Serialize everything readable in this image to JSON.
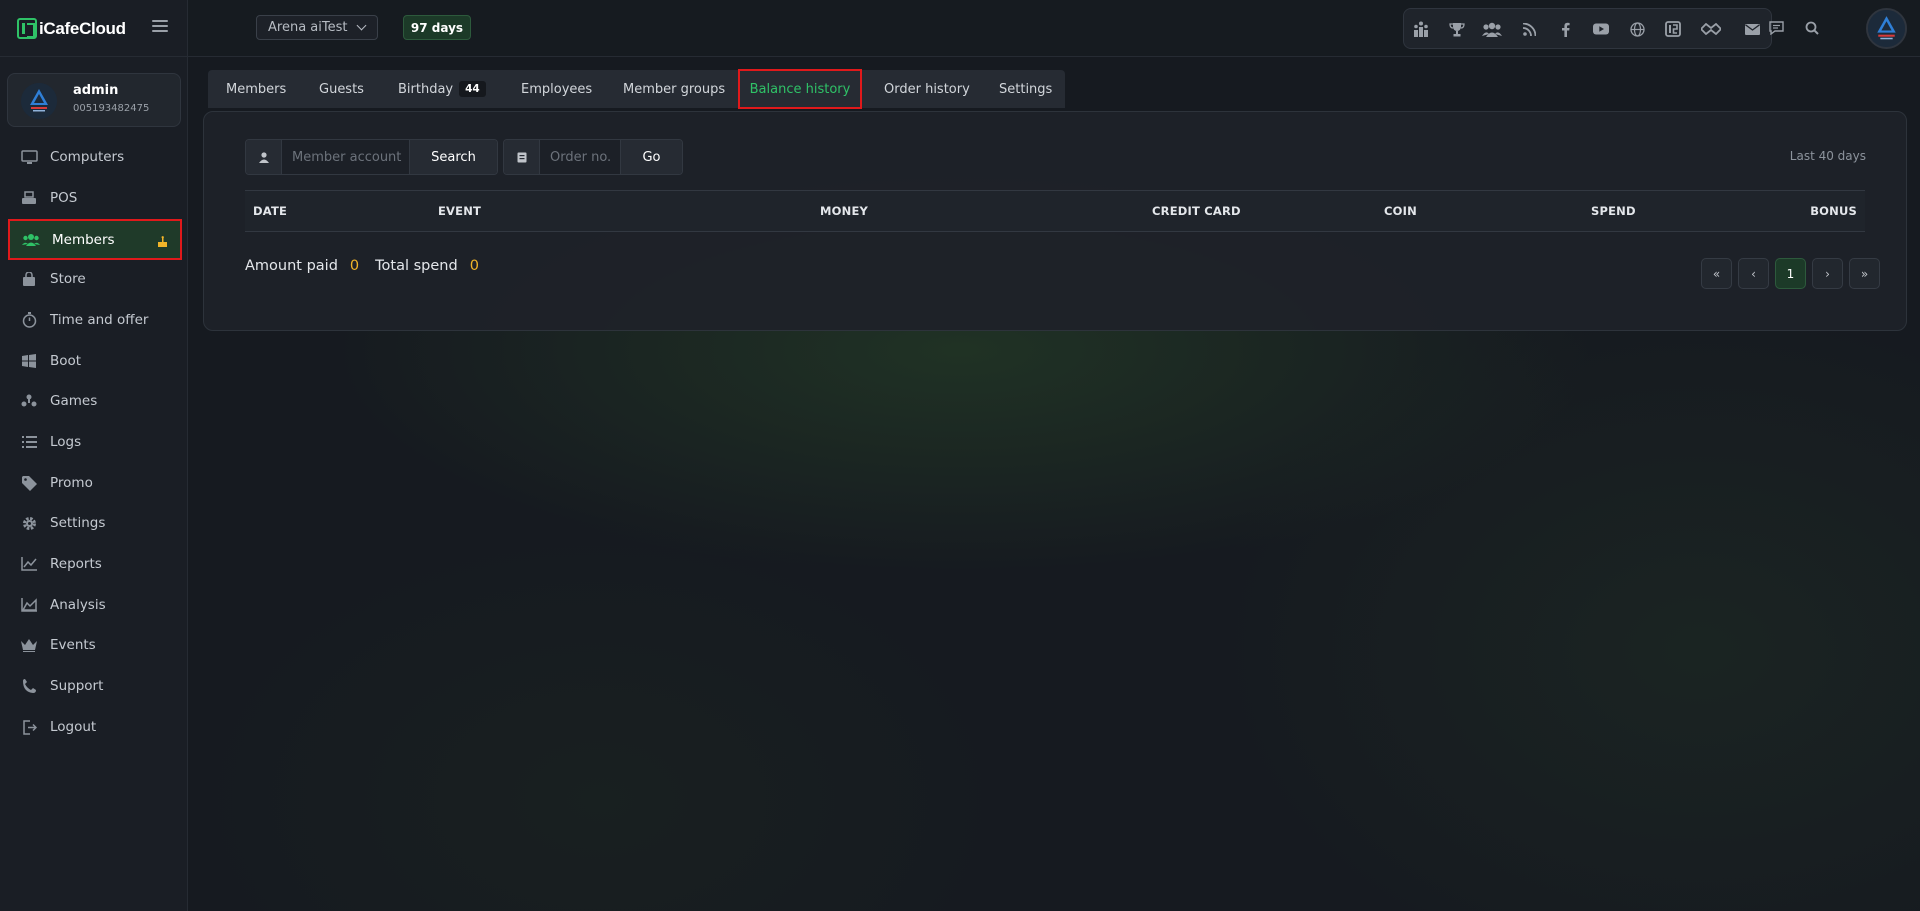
{
  "app": {
    "name": "iCafeCloud"
  },
  "user": {
    "name": "admin",
    "id": "005193482475"
  },
  "sidebar": {
    "items": [
      {
        "label": "Computers",
        "icon": "monitor-icon"
      },
      {
        "label": "POS",
        "icon": "cash-register-icon"
      },
      {
        "label": "Members",
        "icon": "users-icon",
        "active": true
      },
      {
        "label": "Store",
        "icon": "shopping-bag-icon"
      },
      {
        "label": "Time and offer",
        "icon": "stopwatch-icon"
      },
      {
        "label": "Boot",
        "icon": "windows-icon"
      },
      {
        "label": "Games",
        "icon": "gamepad-icon"
      },
      {
        "label": "Logs",
        "icon": "list-icon"
      },
      {
        "label": "Promo",
        "icon": "tag-icon"
      },
      {
        "label": "Settings",
        "icon": "gear-icon"
      },
      {
        "label": "Reports",
        "icon": "line-chart-icon"
      },
      {
        "label": "Analysis",
        "icon": "area-chart-icon"
      },
      {
        "label": "Events",
        "icon": "crown-icon"
      },
      {
        "label": "Support",
        "icon": "phone-icon"
      },
      {
        "label": "Logout",
        "icon": "logout-icon"
      }
    ]
  },
  "header": {
    "branch": "Arena aiTest",
    "days": "97 days",
    "toolbar_icons": [
      "ranking-icon",
      "trophy-icon",
      "group-icon",
      "rss-icon",
      "facebook-icon",
      "youtube-icon",
      "globe-icon",
      "icafe-icon",
      "handshake-icon",
      "mail-icon",
      "chat-icon",
      "search-icon"
    ]
  },
  "tabs": {
    "items": [
      {
        "label": "Members"
      },
      {
        "label": "Guests"
      },
      {
        "label": "Birthday",
        "count": "44"
      },
      {
        "label": "Employees"
      },
      {
        "label": "Member groups"
      },
      {
        "label": "Balance history",
        "active": true
      },
      {
        "label": "Order history"
      },
      {
        "label": "Settings"
      }
    ]
  },
  "filters": {
    "member_placeholder": "Member account",
    "search_label": "Search",
    "order_placeholder": "Order no.",
    "go_label": "Go",
    "range": "Last 40 days"
  },
  "table": {
    "columns": [
      "DATE",
      "EVENT",
      "MONEY",
      "CREDIT CARD",
      "COIN",
      "SPEND",
      "BONUS"
    ],
    "rows": []
  },
  "totals": {
    "amount_paid_label": "Amount paid",
    "amount_paid": "0",
    "total_spend_label": "Total spend",
    "total_spend": "0"
  },
  "pagination": {
    "first": "«",
    "prev": "‹",
    "current": "1",
    "next": "›",
    "last": "»"
  },
  "colors": {
    "accent": "#2fc267",
    "highlight": "#e0191b",
    "number": "#f0b429"
  }
}
